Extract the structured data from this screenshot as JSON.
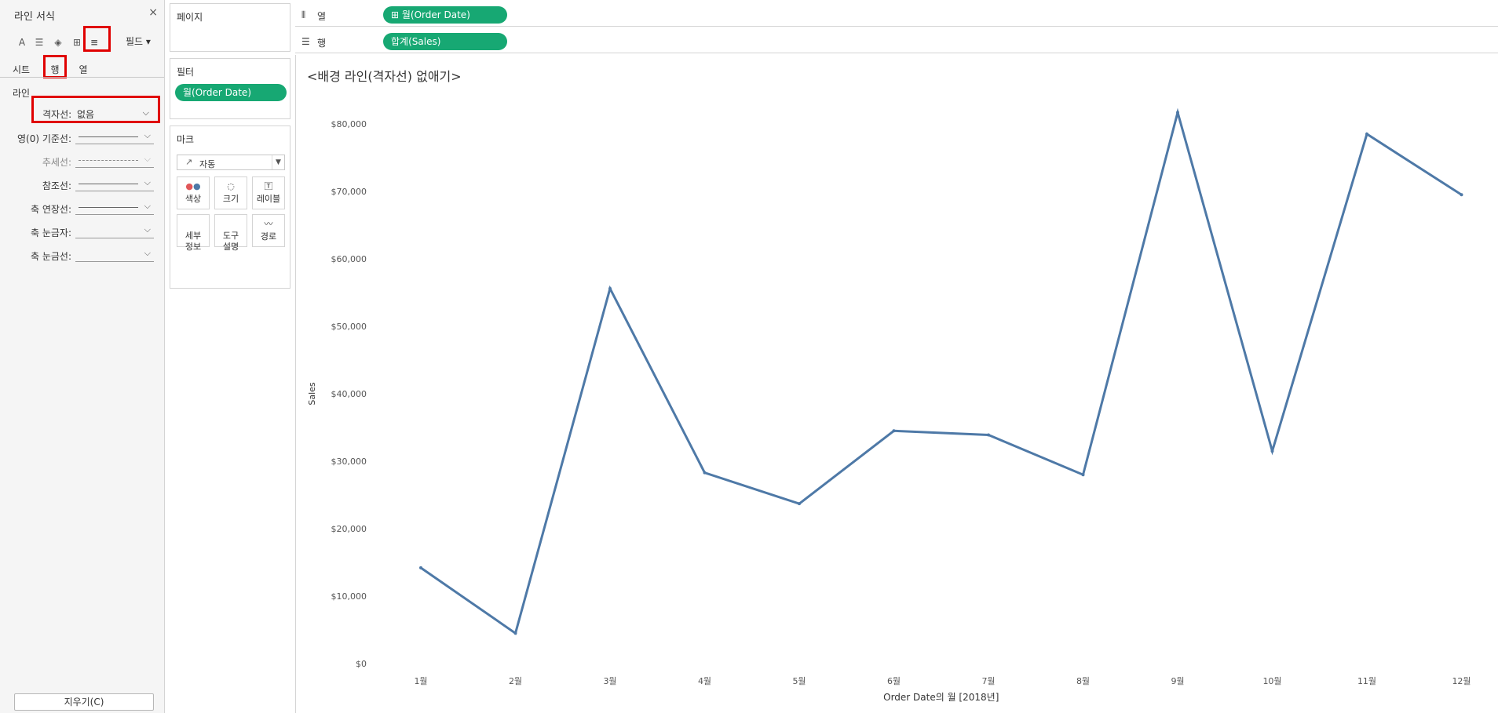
{
  "format_panel": {
    "title": "라인 서식",
    "close": "×",
    "field_dropdown": "필드",
    "tabs": [
      "시트",
      "행",
      "열"
    ],
    "section": "라인",
    "gridline_label": "격자선:",
    "gridline_value": "없음",
    "rows": [
      {
        "label": "영(0) 기준선:",
        "style": "solid"
      },
      {
        "label": "추세선:",
        "style": "dashed"
      },
      {
        "label": "참조선:",
        "style": "solid"
      },
      {
        "label": "축 연장선:",
        "style": "solid"
      },
      {
        "label": "축 눈금자:",
        "style": "none"
      },
      {
        "label": "축 눈금선:",
        "style": "none"
      }
    ],
    "clear_button": "지우기(C)"
  },
  "shelves": {
    "pages": "페이지",
    "filters": "필터",
    "filter_pill": "월(Order Date)",
    "marks": "마크",
    "mark_type": "자동",
    "mark_buttons": [
      {
        "label": "색상",
        "icon": "color-dots-icon"
      },
      {
        "label": "크기",
        "icon": "size-icon"
      },
      {
        "label": "레이블",
        "icon": "label-icon"
      },
      {
        "label": "세부\n정보",
        "icon": "detail-icon"
      },
      {
        "label": "도구\n설명",
        "icon": "tooltip-icon"
      },
      {
        "label": "경로",
        "icon": "path-icon"
      }
    ],
    "columns_label": "열",
    "columns_pill": "⊞ 월(Order Date)",
    "rows_label": "행",
    "rows_pill": "합계(Sales)"
  },
  "view": {
    "title": "<배경 라인(격자선) 없애기>"
  },
  "chart_data": {
    "type": "line",
    "categories": [
      "1월",
      "2월",
      "3월",
      "4월",
      "5월",
      "6월",
      "7월",
      "8월",
      "9월",
      "10월",
      "11월",
      "12월"
    ],
    "series": [
      {
        "values": [
          14200,
          4500,
          55600,
          28300,
          23700,
          34500,
          33900,
          28000,
          81700,
          31500,
          78500,
          69500
        ]
      }
    ],
    "xlabel": "Order Date의 월 [2018년]",
    "ylabel": "Sales",
    "ylim": [
      0,
      80000
    ],
    "yticks": [
      "$0",
      "$10,000",
      "$20,000",
      "$30,000",
      "$40,000",
      "$50,000",
      "$60,000",
      "$70,000",
      "$80,000"
    ],
    "grid": false,
    "line_color": "#4e79a7"
  }
}
